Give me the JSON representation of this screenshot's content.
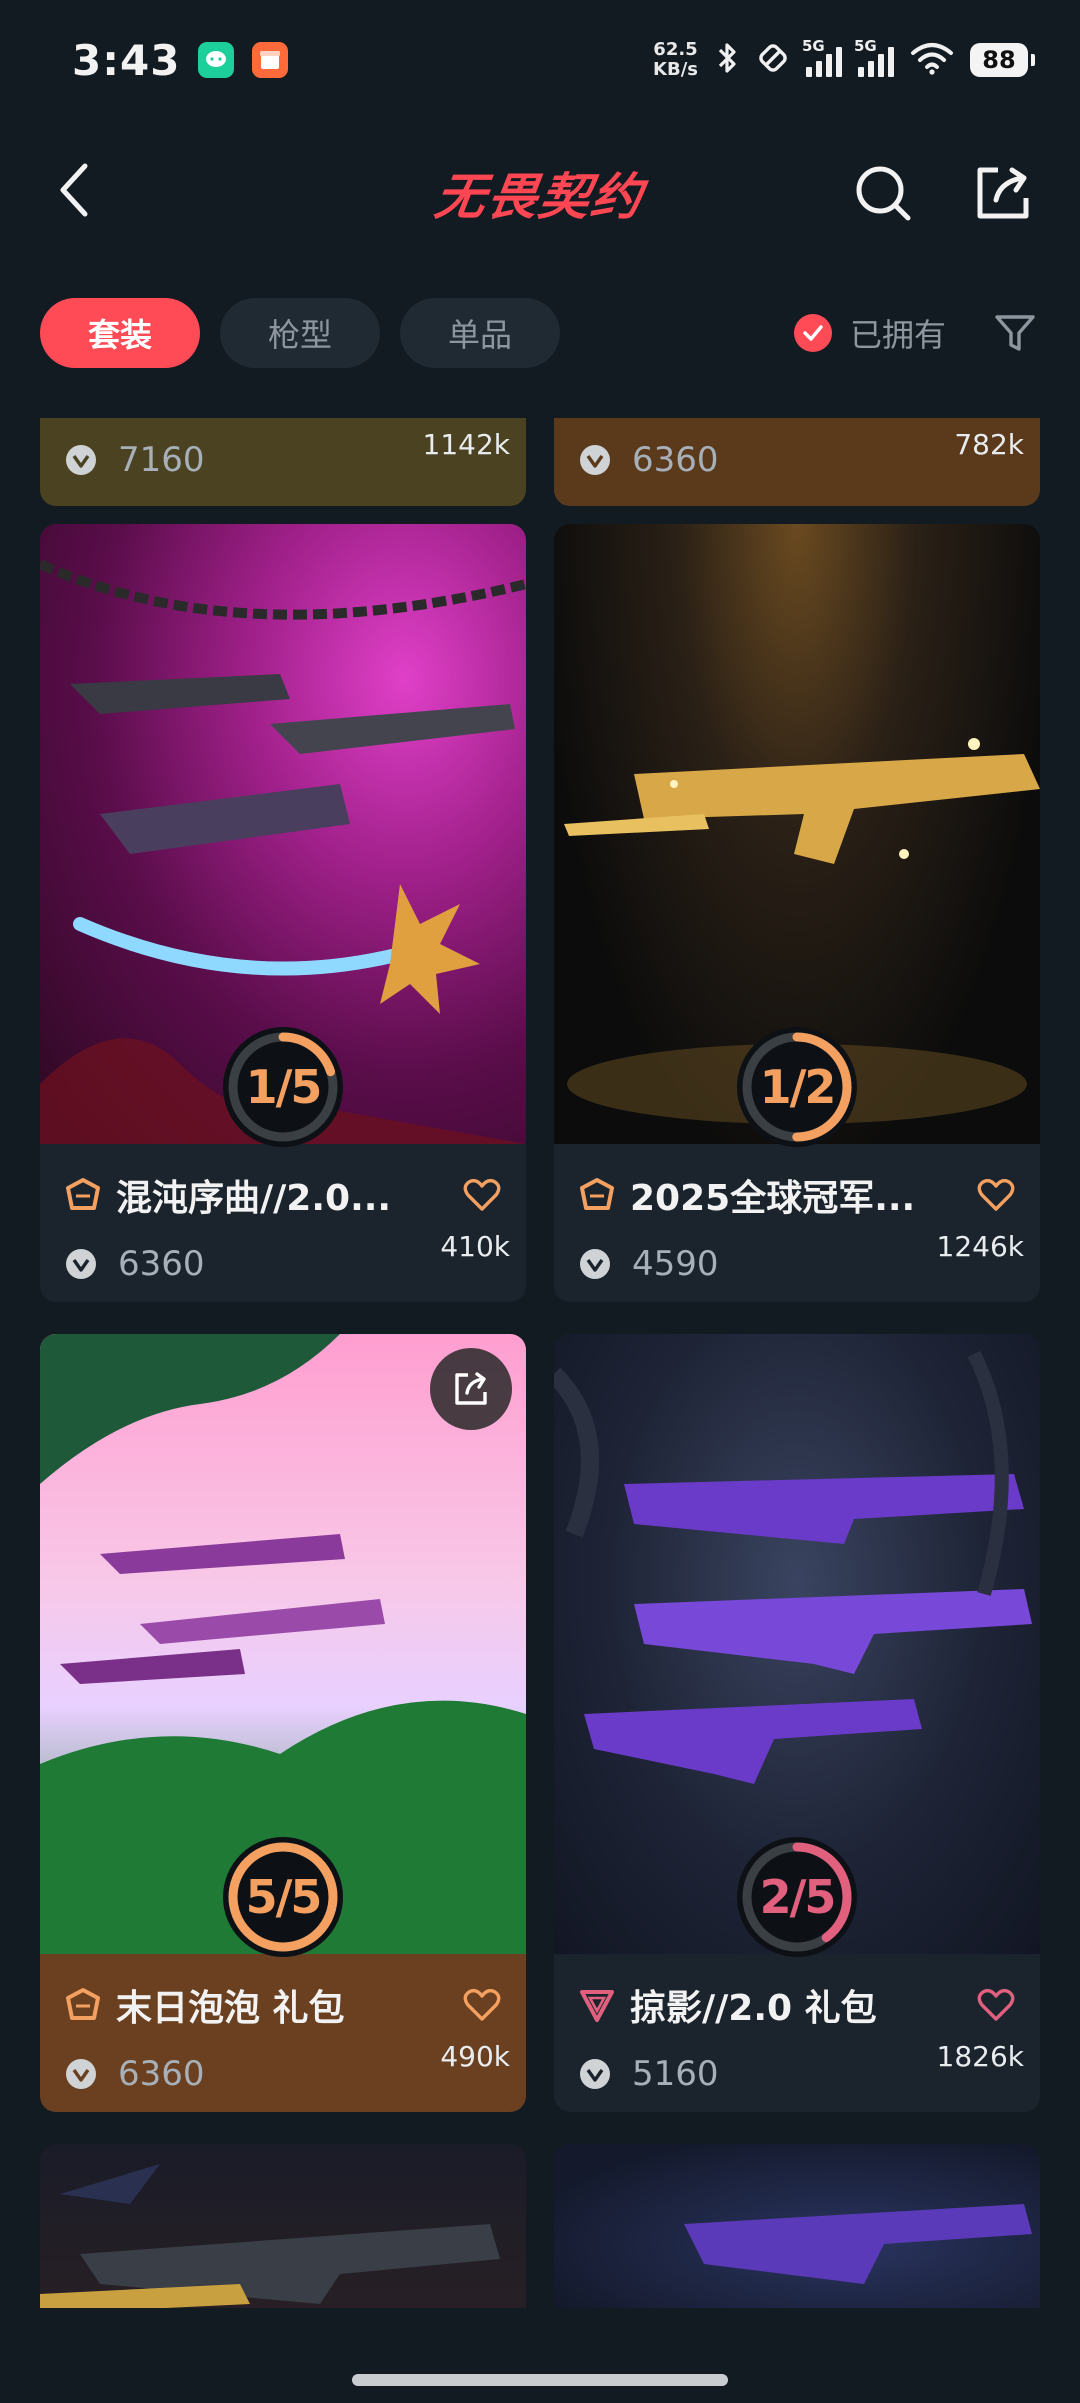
{
  "status_bar": {
    "time": "3:43",
    "net_speed_value": "62.5",
    "net_speed_unit": "KB/s",
    "signal_1_label": "5G",
    "signal_2_label": "5G",
    "battery": "88"
  },
  "header": {
    "logo_text": "无畏契约"
  },
  "filters": {
    "tabs": [
      {
        "label": "套装",
        "active": true
      },
      {
        "label": "枪型",
        "active": false
      },
      {
        "label": "单品",
        "active": false
      }
    ],
    "owned_label": "已拥有"
  },
  "cards": [
    {
      "name": "",
      "price": "7160",
      "likes": "1142k"
    },
    {
      "name": "",
      "price": "6360",
      "likes": "782k"
    },
    {
      "name": "混沌序曲//2.0...",
      "price": "6360",
      "likes": "410k",
      "progress": "1/5",
      "progress_fraction": 0.2
    },
    {
      "name": "2025全球冠军...",
      "price": "4590",
      "likes": "1246k",
      "progress": "1/2",
      "progress_fraction": 0.5
    },
    {
      "name": "末日泡泡 礼包",
      "price": "6360",
      "likes": "490k",
      "progress": "5/5",
      "progress_fraction": 1.0
    },
    {
      "name": "掠影//2.0 礼包",
      "price": "5160",
      "likes": "1826k",
      "progress": "2/5",
      "progress_fraction": 0.4
    }
  ],
  "colors": {
    "accent": "#ff4b55",
    "ring_orange": "#f3a060",
    "ring_pink": "#e0607e",
    "bg": "#121a22",
    "card_info_default": "#1b242d",
    "card_info_olive": "#4a4220",
    "card_info_brown": "#5b3a1c"
  }
}
